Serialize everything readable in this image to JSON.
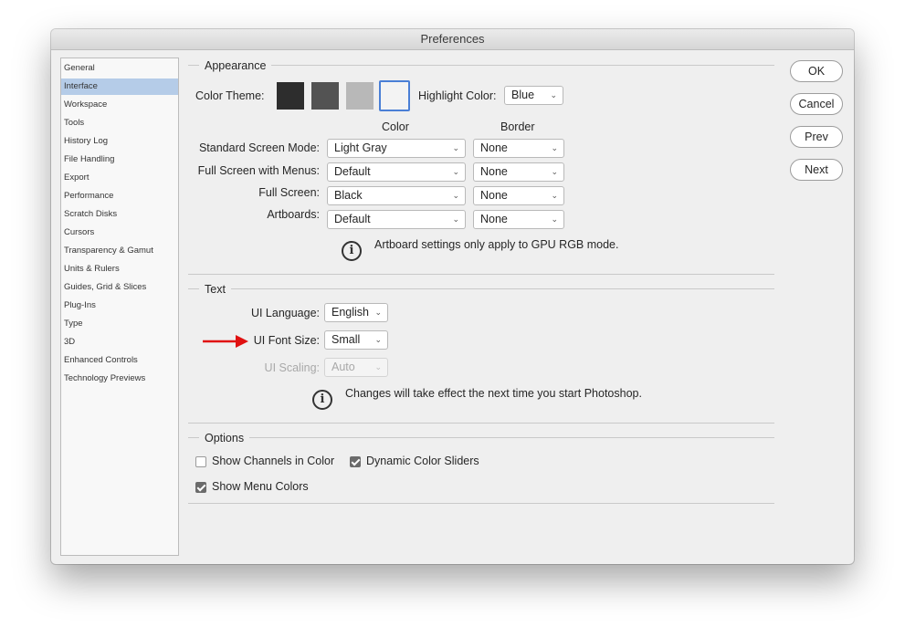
{
  "window": {
    "title": "Preferences"
  },
  "sidebar": {
    "items": [
      {
        "label": "General"
      },
      {
        "label": "Interface",
        "selected": true
      },
      {
        "label": "Workspace"
      },
      {
        "label": "Tools"
      },
      {
        "label": "History Log"
      },
      {
        "label": "File Handling"
      },
      {
        "label": "Export"
      },
      {
        "label": "Performance"
      },
      {
        "label": "Scratch Disks"
      },
      {
        "label": "Cursors"
      },
      {
        "label": "Transparency & Gamut"
      },
      {
        "label": "Units & Rulers"
      },
      {
        "label": "Guides, Grid & Slices"
      },
      {
        "label": "Plug-Ins"
      },
      {
        "label": "Type"
      },
      {
        "label": "3D"
      },
      {
        "label": "Enhanced Controls"
      },
      {
        "label": "Technology Previews"
      }
    ]
  },
  "appearance": {
    "title": "Appearance",
    "color_theme_label": "Color Theme:",
    "theme_swatches": [
      "#2d2d2d",
      "#535353",
      "#b8b8b8",
      "#f3f3f3"
    ],
    "selected_theme_index": 3,
    "highlight_label": "Highlight Color:",
    "highlight_value": "Blue",
    "col_color": "Color",
    "col_border": "Border",
    "rows": [
      {
        "label": "Standard Screen Mode:",
        "color": "Light Gray",
        "border": "None"
      },
      {
        "label": "Full Screen with Menus:",
        "color": "Default",
        "border": "None"
      },
      {
        "label": "Full Screen:",
        "color": "Black",
        "border": "None"
      },
      {
        "label": "Artboards:",
        "color": "Default",
        "border": "None"
      }
    ],
    "note": "Artboard settings only apply to GPU RGB mode."
  },
  "text_section": {
    "title": "Text",
    "ui_language_label": "UI Language:",
    "ui_language_value": "English",
    "ui_font_size_label": "UI Font Size:",
    "ui_font_size_value": "Small",
    "ui_scaling_label": "UI Scaling:",
    "ui_scaling_value": "Auto",
    "note": "Changes will take effect the next time you start Photoshop."
  },
  "options": {
    "title": "Options",
    "show_channels_label": "Show Channels in Color",
    "show_channels_checked": false,
    "dynamic_sliders_label": "Dynamic Color Sliders",
    "dynamic_sliders_checked": true,
    "show_menu_colors_label": "Show Menu Colors",
    "show_menu_colors_checked": true
  },
  "buttons": {
    "ok": "OK",
    "cancel": "Cancel",
    "prev": "Prev",
    "next": "Next"
  },
  "annotation": {
    "arrow_color": "#e01010"
  },
  "icons": {
    "info": "info-icon",
    "chevron": "chevron-down-icon",
    "arrow": "red-arrow-icon"
  }
}
